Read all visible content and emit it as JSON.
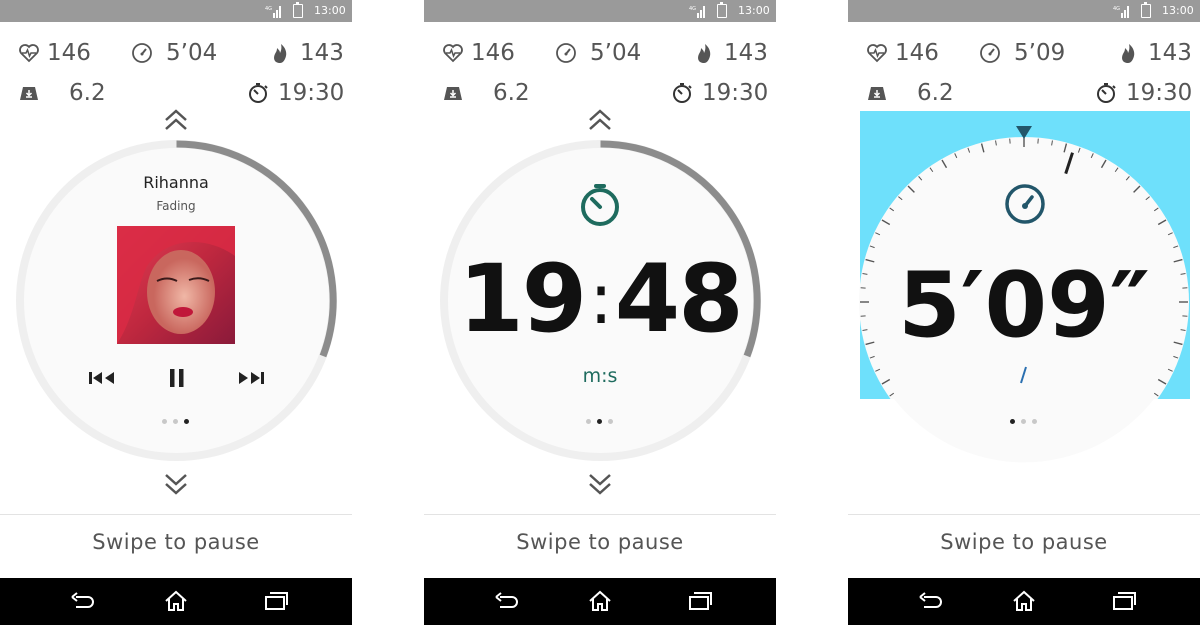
{
  "status_bar": {
    "time": "13:00",
    "signal_label": "4G"
  },
  "screens": [
    {
      "stats": {
        "heart_rate": "146",
        "pace": "5’04",
        "calories": "143",
        "distance": "6.2",
        "duration": "19:30"
      },
      "music": {
        "artist": "Rihanna",
        "track": "Fading"
      },
      "page_dots": {
        "total": 3,
        "active": 3
      },
      "swipe_text": "Swipe to pause",
      "progress_fraction": 0.3
    },
    {
      "stats": {
        "heart_rate": "146",
        "pace": "5’04",
        "calories": "143",
        "distance": "6.2",
        "duration": "19:30"
      },
      "timer": {
        "minutes": "19",
        "seconds": "48",
        "separator": ":",
        "unit": "m:s"
      },
      "page_dots": {
        "total": 3,
        "active": 2
      },
      "swipe_text": "Swipe to pause",
      "progress_fraction": 0.3
    },
    {
      "stats": {
        "heart_rate": "146",
        "pace": "5’09",
        "calories": "143",
        "distance": "6.2",
        "duration": "19:30"
      },
      "pace_gauge": {
        "value": "5′09″"
      },
      "page_dots": {
        "total": 3,
        "active": 1
      },
      "swipe_text": "Swipe to pause"
    }
  ],
  "icons": {
    "heart_rate": "heart-rate-icon",
    "pace": "speedometer-icon",
    "calories": "flame-icon",
    "distance": "distance-icon",
    "duration": "stopwatch-icon",
    "scroll_up": "chevron-double-up-icon",
    "scroll_down": "chevron-double-down-icon",
    "nav_back": "back-icon",
    "nav_home": "home-icon",
    "nav_recent": "recent-apps-icon"
  },
  "colors": {
    "accent": "#1e6b5e",
    "pace_background": "#6ee0fb",
    "status_bar": "#9a9a9a",
    "nav_bar": "#000000"
  }
}
